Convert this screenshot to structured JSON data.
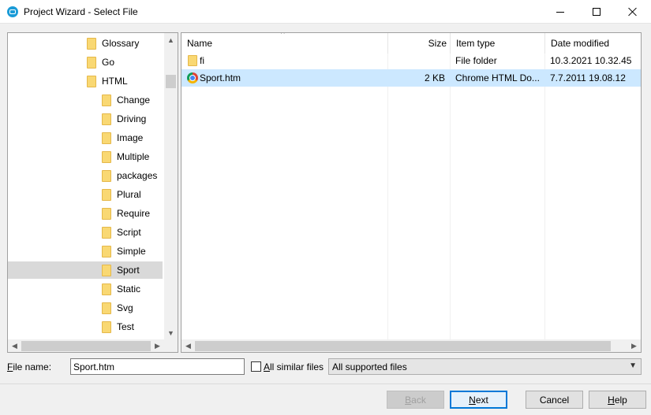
{
  "window": {
    "title": "Project Wizard - Select File",
    "accent": "#1a9bd7"
  },
  "tree": {
    "items": [
      {
        "label": "Glossary",
        "level": 1
      },
      {
        "label": "Go",
        "level": 1
      },
      {
        "label": "HTML",
        "level": 1
      },
      {
        "label": "Change",
        "level": 2
      },
      {
        "label": "Driving",
        "level": 2
      },
      {
        "label": "Image",
        "level": 2
      },
      {
        "label": "Multiple",
        "level": 2
      },
      {
        "label": "packages",
        "level": 2
      },
      {
        "label": "Plural",
        "level": 2
      },
      {
        "label": "Require",
        "level": 2
      },
      {
        "label": "Script",
        "level": 2
      },
      {
        "label": "Simple",
        "level": 2
      },
      {
        "label": "Sport",
        "level": 2,
        "selected": true
      },
      {
        "label": "Static",
        "level": 2
      },
      {
        "label": "Svg",
        "level": 2
      },
      {
        "label": "Test",
        "level": 2
      }
    ]
  },
  "list": {
    "columns": {
      "name": "Name",
      "size": "Size",
      "type": "Item type",
      "modified": "Date modified"
    },
    "rows": [
      {
        "name": "fi",
        "size": "",
        "type": "File folder",
        "modified": "10.3.2021 10.32.45",
        "icon": "folder-icon"
      },
      {
        "name": "Sport.htm",
        "size": "2 KB",
        "type": "Chrome HTML Do...",
        "modified": "7.7.2011 19.08.12",
        "icon": "chrome-icon",
        "selected": true
      }
    ]
  },
  "form": {
    "filename_label_u": "F",
    "filename_label_rest": "ile name:",
    "filename_value": "Sport.htm",
    "similar_u": "A",
    "similar_rest": "ll similar files",
    "filetype_value": "All supported files"
  },
  "buttons": {
    "back_u": "B",
    "back_rest": "ack",
    "next_u": "N",
    "next_rest": "ext",
    "cancel": "Cancel",
    "help_u": "H",
    "help_rest": "elp"
  },
  "colors": {
    "selection_list": "#cce8ff",
    "selection_tree": "#d9d9d9",
    "default_button_border": "#0078d7"
  }
}
